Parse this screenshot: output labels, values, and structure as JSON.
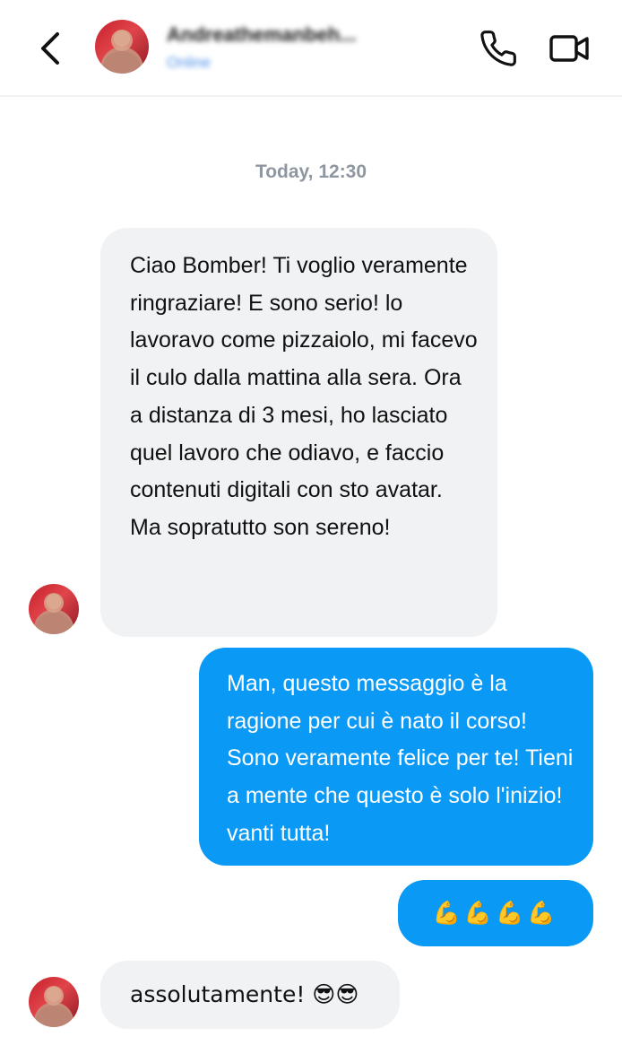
{
  "header": {
    "contact_name": "Andreathemanbeh...",
    "contact_status": "Online",
    "back_icon": "chevron-left-icon",
    "call_icon": "phone-icon",
    "video_icon": "video-camera-icon"
  },
  "chat": {
    "timestamp": "Today, 12:30",
    "messages": [
      {
        "direction": "incoming",
        "text": "Ciao Bomber! Ti voglio veramente ringraziare! E sono serio! lo lavoravo come pizzaiolo, mi facevo il culo dalla mattina alla sera. Ora a distanza di 3 mesi, ho lasciato quel lavoro che odiavo, e faccio contenuti digitali con sto avatar. Ma sopratutto son sereno!"
      },
      {
        "direction": "outgoing",
        "text": "Man, questo messaggio è la ragione per cui è nato il corso! Sono veramente felice per te! Tieni a mente che questo è solo l'inizio! vanti tutta!"
      },
      {
        "direction": "outgoing",
        "text": "💪💪💪💪"
      },
      {
        "direction": "incoming",
        "text": "assolutamente! 😎😎"
      }
    ]
  },
  "colors": {
    "outgoing_bubble": "#0a99f5",
    "incoming_bubble": "#f1f2f4",
    "timestamp": "#8e96a0"
  }
}
